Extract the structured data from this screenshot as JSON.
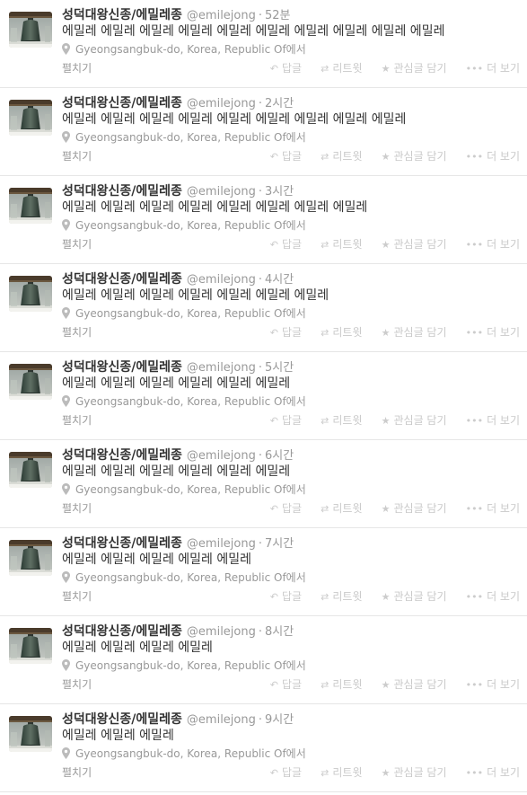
{
  "tweets": [
    {
      "fullname": "성덕대왕신종/에밀레종",
      "username": "@emilejong",
      "time": "52분",
      "text": "에밀레 에밀레 에밀레 에밀레 에밀레 에밀레 에밀레 에밀레 에밀레 에밀레",
      "location": "Gyeongsangbuk-do, Korea, Republic Of에서"
    },
    {
      "fullname": "성덕대왕신종/에밀레종",
      "username": "@emilejong",
      "time": "2시간",
      "text": "에밀레 에밀레 에밀레 에밀레 에밀레 에밀레 에밀레 에밀레 에밀레",
      "location": "Gyeongsangbuk-do, Korea, Republic Of에서"
    },
    {
      "fullname": "성덕대왕신종/에밀레종",
      "username": "@emilejong",
      "time": "3시간",
      "text": "에밀레 에밀레 에밀레 에밀레 에밀레 에밀레 에밀레 에밀레",
      "location": "Gyeongsangbuk-do, Korea, Republic Of에서"
    },
    {
      "fullname": "성덕대왕신종/에밀레종",
      "username": "@emilejong",
      "time": "4시간",
      "text": "에밀레 에밀레 에밀레 에밀레 에밀레 에밀레 에밀레",
      "location": "Gyeongsangbuk-do, Korea, Republic Of에서"
    },
    {
      "fullname": "성덕대왕신종/에밀레종",
      "username": "@emilejong",
      "time": "5시간",
      "text": "에밀레 에밀레 에밀레 에밀레 에밀레 에밀레",
      "location": "Gyeongsangbuk-do, Korea, Republic Of에서"
    },
    {
      "fullname": "성덕대왕신종/에밀레종",
      "username": "@emilejong",
      "time": "6시간",
      "text": "에밀레 에밀레 에밀레 에밀레 에밀레 에밀레",
      "location": "Gyeongsangbuk-do, Korea, Republic Of에서"
    },
    {
      "fullname": "성덕대왕신종/에밀레종",
      "username": "@emilejong",
      "time": "7시간",
      "text": "에밀레 에밀레 에밀레 에밀레 에밀레",
      "location": "Gyeongsangbuk-do, Korea, Republic Of에서"
    },
    {
      "fullname": "성덕대왕신종/에밀레종",
      "username": "@emilejong",
      "time": "8시간",
      "text": "에밀레 에밀레 에밀레 에밀레",
      "location": "Gyeongsangbuk-do, Korea, Republic Of에서"
    },
    {
      "fullname": "성덕대왕신종/에밀레종",
      "username": "@emilejong",
      "time": "9시간",
      "text": "에밀레 에밀레 에밀레",
      "location": "Gyeongsangbuk-do, Korea, Republic Of에서"
    }
  ],
  "labels": {
    "separator": "·",
    "expand": "펼치기",
    "reply": "답글",
    "retweet": "리트윗",
    "favorite": "관심글 담기",
    "more": "더 보기"
  },
  "icons": {
    "location": "map-pin-icon",
    "reply": "reply-arrow-icon",
    "retweet": "retweet-arrows-icon",
    "favorite": "star-icon",
    "more": "ellipsis-icon"
  },
  "colors": {
    "name": "#333333",
    "meta": "#999999",
    "action": "#c9c9c9",
    "divider": "#e6e6e6"
  }
}
